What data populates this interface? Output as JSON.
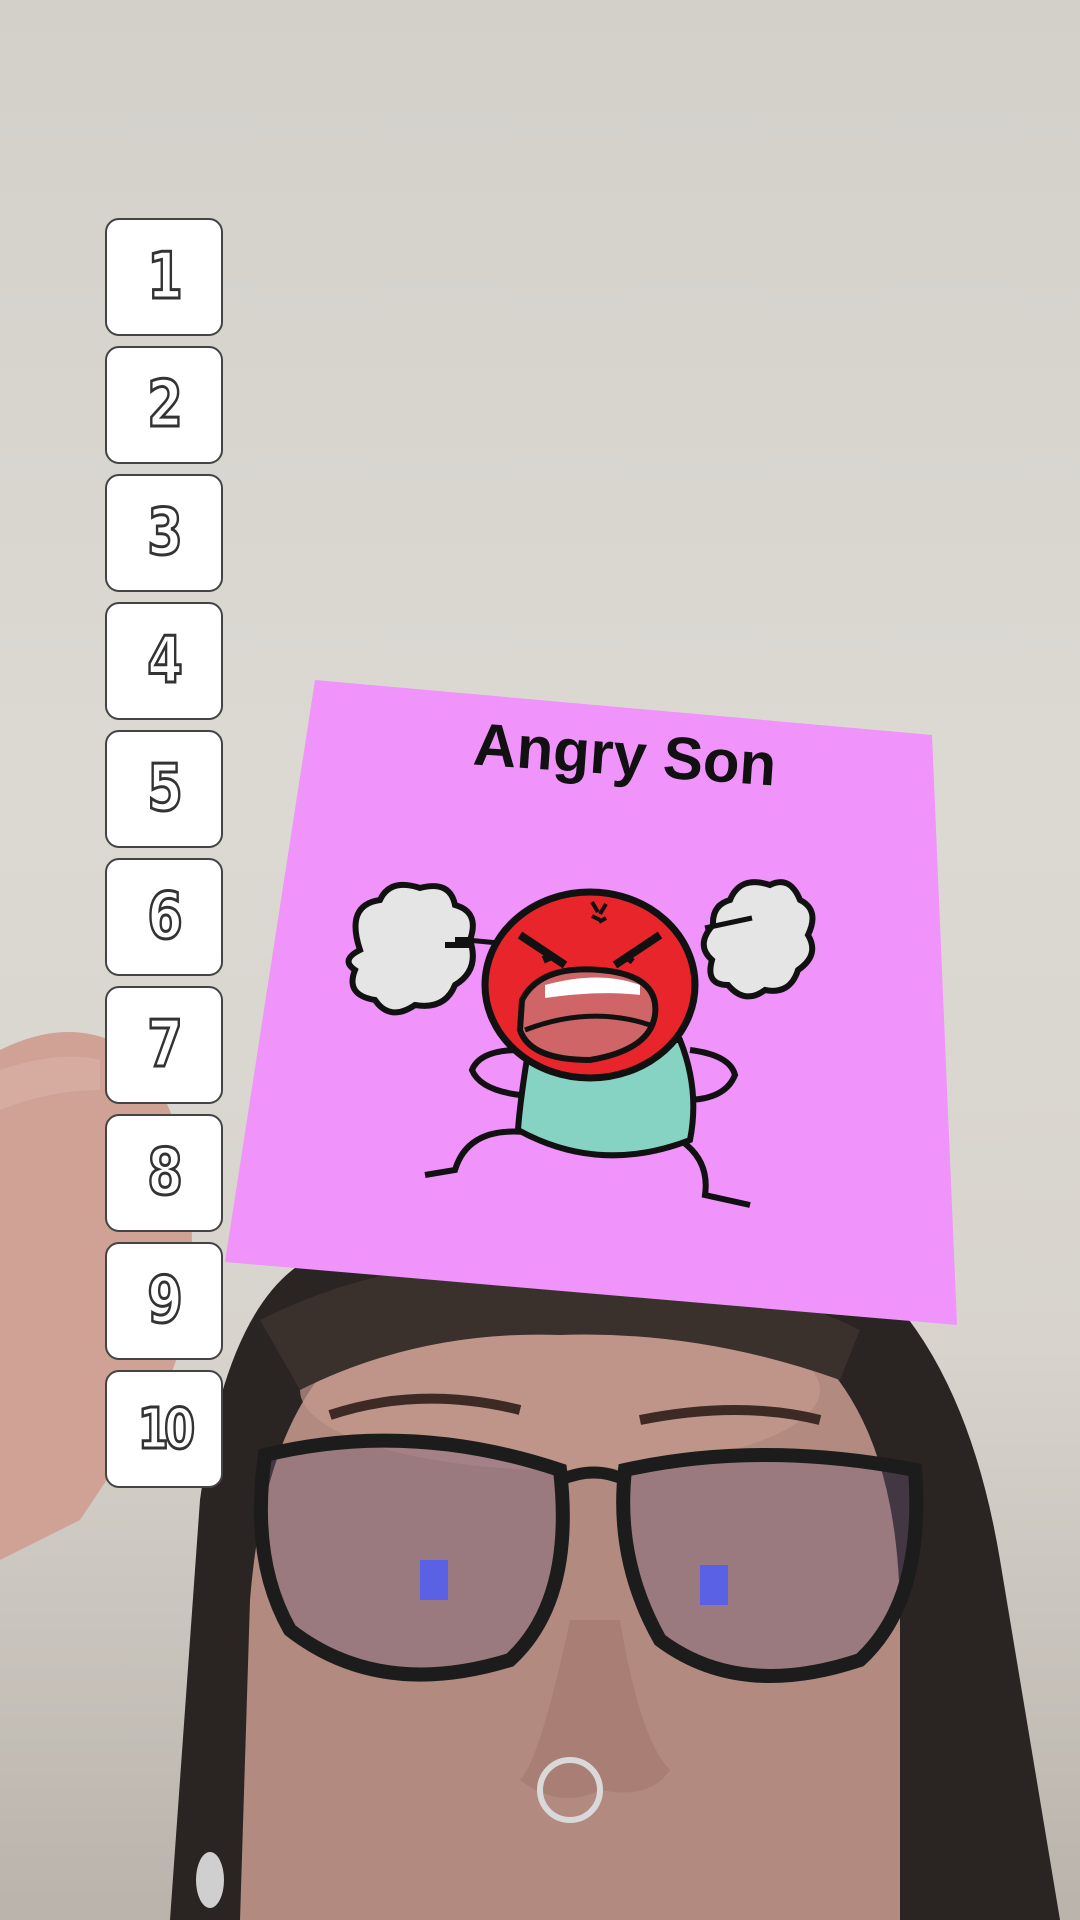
{
  "ranking": {
    "slots": [
      "1",
      "2",
      "3",
      "4",
      "5",
      "6",
      "7",
      "8",
      "9",
      "10"
    ]
  },
  "card": {
    "title": "Angry Son",
    "background_color": "#f093fb",
    "face_color": "#e8252a",
    "shirt_color": "#86d3c3",
    "steam_color": "#e5e5e5"
  },
  "icons": [
    "angry-character-icon",
    "steam-cloud-icon"
  ]
}
